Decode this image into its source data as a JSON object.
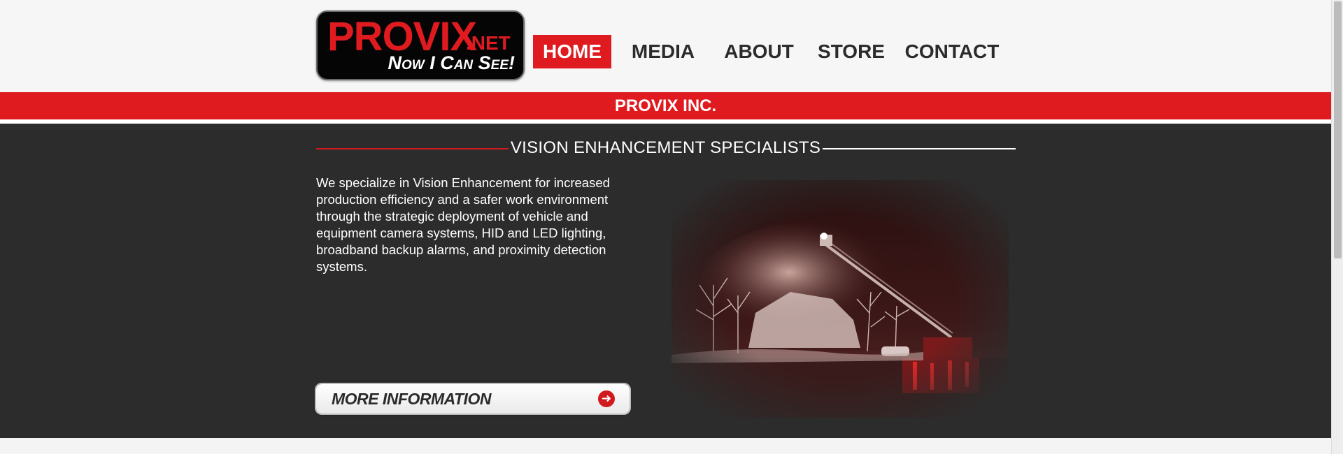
{
  "logo": {
    "word": "PROVIX",
    "tld": ".NET",
    "tagline": "Now I Can See!"
  },
  "nav": {
    "items": [
      {
        "label": "HOME",
        "active": true
      },
      {
        "label": "MEDIA",
        "active": false
      },
      {
        "label": "ABOUT",
        "active": false
      },
      {
        "label": "STORE",
        "active": false
      },
      {
        "label": "CONTACT",
        "active": false
      }
    ]
  },
  "banner": {
    "company": "PROVIX INC."
  },
  "section": {
    "title": "VISION ENHANCEMENT SPECIALISTS",
    "description": "We specialize in Vision Enhancement for increased production efficiency and a safer work environment through the strategic deployment of vehicle and equipment camera systems, HID and LED lighting, broadband backup alarms, and proximity detection systems.",
    "button_label": "MORE INFORMATION",
    "button_icon": "arrow-right-circle-icon"
  },
  "colors": {
    "brand_red": "#e01b1f",
    "dark_bg": "#2c2c2c",
    "header_bg": "#f6f6f6"
  }
}
